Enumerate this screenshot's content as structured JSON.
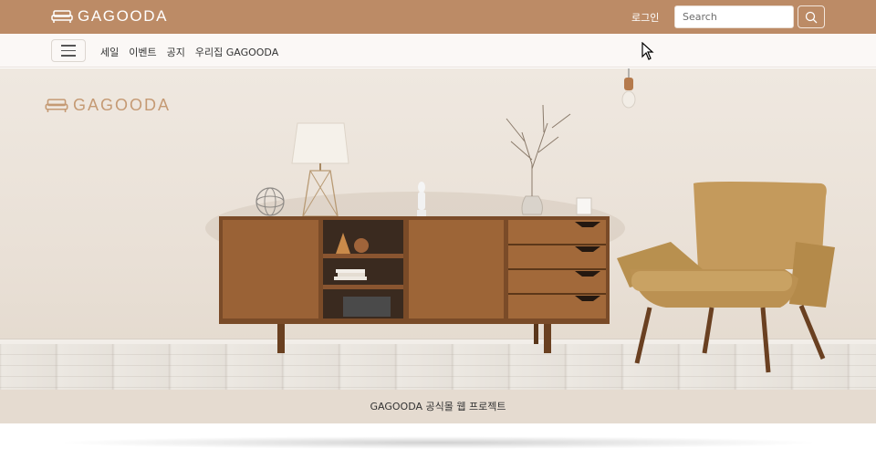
{
  "header": {
    "brand": "GAGOODA",
    "login_label": "로그인",
    "search_placeholder": "Search",
    "search_icon": "search-icon",
    "background_color": "#bc8b66"
  },
  "nav": {
    "menu_icon": "hamburger-menu-icon",
    "items": [
      {
        "label": "세일"
      },
      {
        "label": "이벤트"
      },
      {
        "label": "공지"
      },
      {
        "label": "우리집 GAGOODA"
      }
    ]
  },
  "hero": {
    "logo_text": "GAGOODA",
    "logo_icon": "sofa-icon",
    "scene": "wooden-sideboard-and-armchair"
  },
  "footer": {
    "caption": "GAGOODA 공식몰 웹 프로젝트",
    "background_color": "#e5dbd0"
  }
}
